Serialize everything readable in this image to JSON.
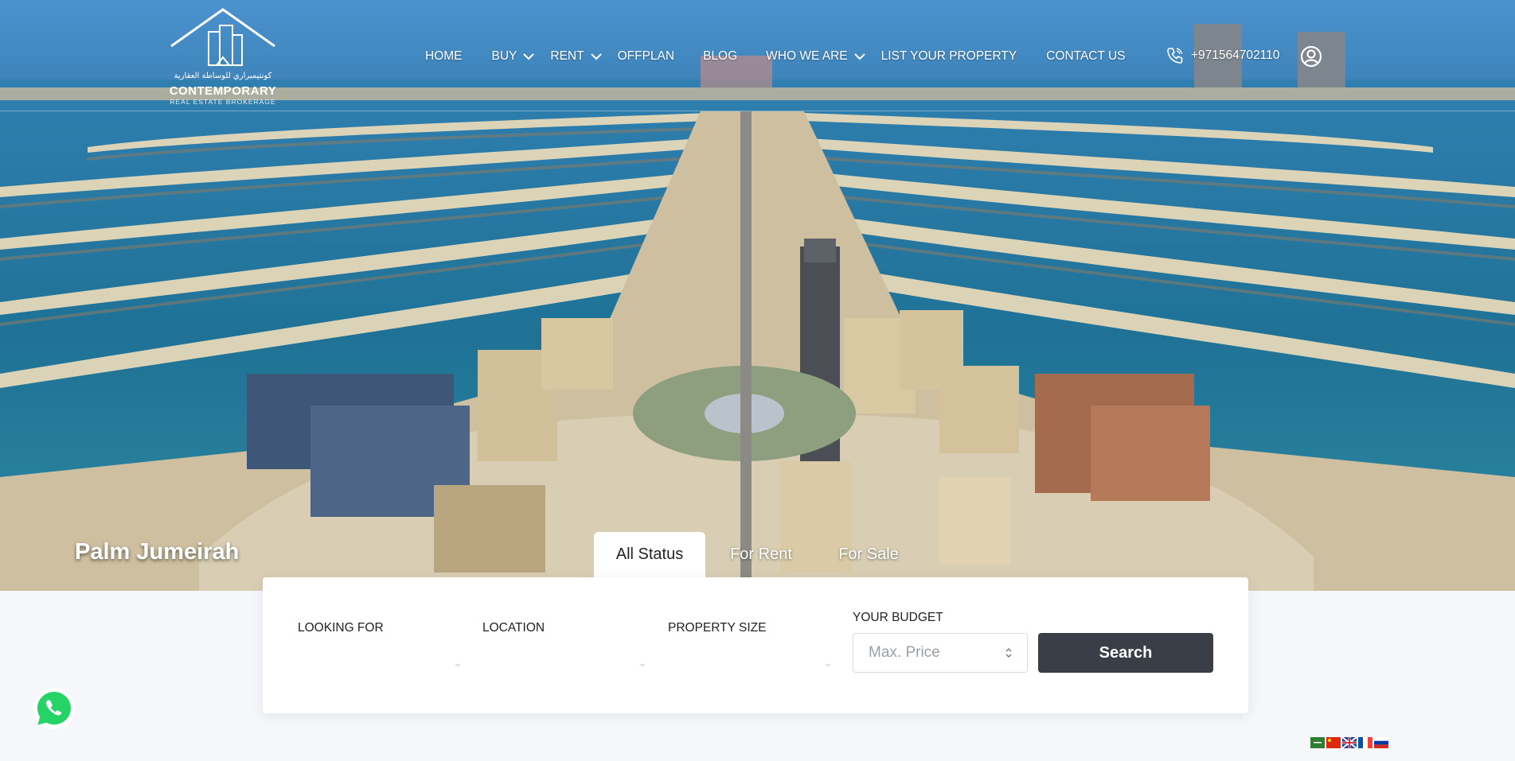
{
  "brand": {
    "arabic": "كونتيمبراري للوساطة العقارية",
    "name": "CONTEMPORARY",
    "sub": "REAL ESTATE BROKERAGE"
  },
  "nav": {
    "items": [
      {
        "label": "HOME",
        "dropdown": false
      },
      {
        "label": "BUY",
        "dropdown": true
      },
      {
        "label": "RENT",
        "dropdown": true
      },
      {
        "label": "OFFPLAN",
        "dropdown": false
      },
      {
        "label": "BLOG",
        "dropdown": false
      },
      {
        "label": "WHO WE ARE",
        "dropdown": true
      },
      {
        "label": "LIST YOUR PROPERTY",
        "dropdown": false
      },
      {
        "label": "CONTACT US",
        "dropdown": false
      }
    ],
    "phone": "+971564702110"
  },
  "hero": {
    "place": "Palm Jumeirah"
  },
  "tabs": [
    {
      "label": "All Status",
      "active": true
    },
    {
      "label": "For Rent",
      "active": false
    },
    {
      "label": "For Sale",
      "active": false
    }
  ],
  "search": {
    "looking_for_label": "LOOKING FOR",
    "location_label": "LOCATION",
    "property_size_label": "PROPERTY SIZE",
    "budget_label": "YOUR BUDGET",
    "budget_placeholder": "Max. Price",
    "button": "Search"
  },
  "flags": [
    "ar",
    "zh",
    "en",
    "fr",
    "ru"
  ],
  "colors": {
    "button_bg": "#3a3f47",
    "whatsapp": "#25d366"
  }
}
